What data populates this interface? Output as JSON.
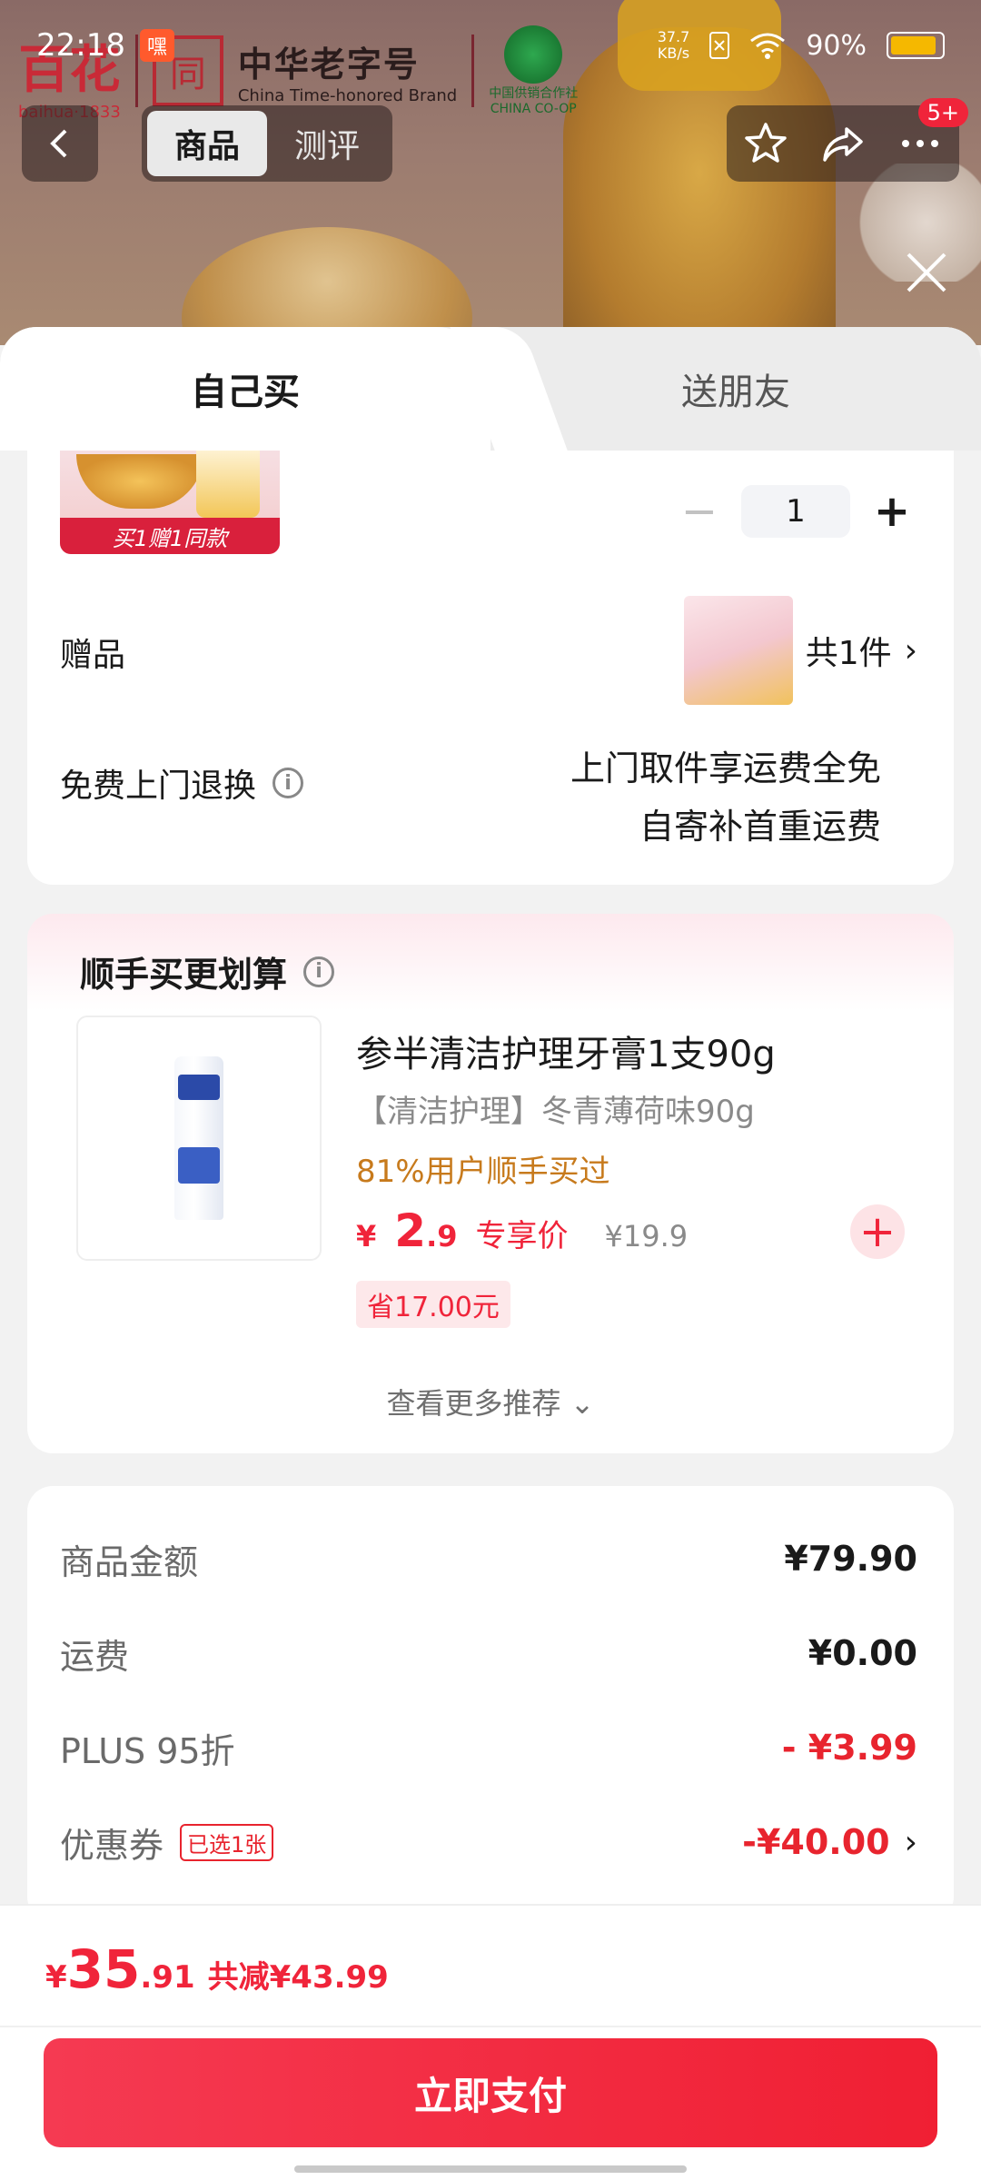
{
  "status_bar": {
    "time": "22:18",
    "app_badge": "嘿",
    "net_speed_value": "37.7",
    "net_speed_unit": "KB/s",
    "battery": "90%"
  },
  "brand": {
    "logo": "百花",
    "logo_sub": "baihua·1833",
    "seal": "同",
    "name_cn": "中华老字号",
    "name_en": "China Time-honored Brand",
    "coop_name": "中国供销合作社",
    "coop_en": "CHINA CO-OP"
  },
  "nav": {
    "tabs": [
      "商品",
      "测评"
    ],
    "more_badge": "5+"
  },
  "sheet_tabs": [
    "自己买",
    "送朋友"
  ],
  "item": {
    "ribbon": "买1赠1同款",
    "quantity": "1",
    "minus": "−",
    "plus": "+"
  },
  "gift": {
    "label": "赠品",
    "count": "共1件",
    "chevron": "›"
  },
  "returns": {
    "label": "免费上门退换",
    "info": "i",
    "line1": "上门取件享运费全免",
    "line2": "自寄补首重运费"
  },
  "recommend": {
    "title": "顺手买更划算",
    "info": "i",
    "product_name": "参半清洁护理牙膏1支90g",
    "spec": "【清洁护理】冬青薄荷味90g",
    "stat": "81%用户顺手买过",
    "price_symbol": "¥",
    "price_int": "2",
    "price_dec": ".9",
    "price_tag": "专享价",
    "orig_price": "¥19.9",
    "save": "省17.00元",
    "add": "+",
    "more": "查看更多推荐 ⌄"
  },
  "summary": {
    "rows": [
      {
        "label": "商品金额",
        "value": "¥79.90"
      },
      {
        "label": "运费",
        "value": "¥0.00"
      },
      {
        "label": "PLUS 95折",
        "value": "- ¥3.99"
      },
      {
        "label": "优惠券",
        "badge": "已选1张",
        "value": "-¥40.00"
      }
    ],
    "chevron": "›"
  },
  "total": {
    "symbol": "¥",
    "int": "35",
    "dec": ".91",
    "reduce": "共减¥43.99"
  },
  "pay_button": "立即支付",
  "colors": {
    "accent": "#f0243a",
    "warning": "#c77a1c"
  }
}
